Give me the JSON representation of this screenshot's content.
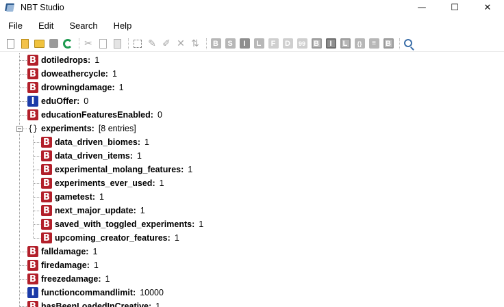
{
  "window": {
    "title": "NBT Studio",
    "controls": {
      "minimize": "—",
      "maximize": "☐",
      "close": "✕"
    }
  },
  "menu": [
    "File",
    "Edit",
    "Search",
    "Help"
  ],
  "toolbar": {
    "tag_buttons": [
      "B",
      "S",
      "I",
      "L",
      "F",
      "D",
      "99",
      "B",
      "I",
      "L",
      "{}",
      "B"
    ]
  },
  "tree": {
    "items": [
      {
        "type": "byte",
        "name": "dotiledrops:",
        "value": "1",
        "depth": 0
      },
      {
        "type": "byte",
        "name": "doweathercycle:",
        "value": "1",
        "depth": 0
      },
      {
        "type": "byte",
        "name": "drowningdamage:",
        "value": "1",
        "depth": 0
      },
      {
        "type": "int",
        "name": "eduOffer:",
        "value": "0",
        "depth": 0
      },
      {
        "type": "byte",
        "name": "educationFeaturesEnabled:",
        "value": "0",
        "depth": 0
      },
      {
        "type": "compound",
        "name": "experiments:",
        "value": "[8 entries]",
        "depth": 0,
        "expanded": true
      },
      {
        "type": "byte",
        "name": "data_driven_biomes:",
        "value": "1",
        "depth": 1
      },
      {
        "type": "byte",
        "name": "data_driven_items:",
        "value": "1",
        "depth": 1
      },
      {
        "type": "byte",
        "name": "experimental_molang_features:",
        "value": "1",
        "depth": 1
      },
      {
        "type": "byte",
        "name": "experiments_ever_used:",
        "value": "1",
        "depth": 1
      },
      {
        "type": "byte",
        "name": "gametest:",
        "value": "1",
        "depth": 1
      },
      {
        "type": "byte",
        "name": "next_major_update:",
        "value": "1",
        "depth": 1
      },
      {
        "type": "byte",
        "name": "saved_with_toggled_experiments:",
        "value": "1",
        "depth": 1
      },
      {
        "type": "byte",
        "name": "upcoming_creator_features:",
        "value": "1",
        "depth": 1
      },
      {
        "type": "byte",
        "name": "falldamage:",
        "value": "1",
        "depth": 0
      },
      {
        "type": "byte",
        "name": "firedamage:",
        "value": "1",
        "depth": 0
      },
      {
        "type": "byte",
        "name": "freezedamage:",
        "value": "1",
        "depth": 0
      },
      {
        "type": "int",
        "name": "functioncommandlimit:",
        "value": "10000",
        "depth": 0
      },
      {
        "type": "byte",
        "name": "hasBeenLoadedInCreative:",
        "value": "1",
        "depth": 0
      }
    ],
    "badge_letters": {
      "byte": "B",
      "int": "I",
      "compound": "{}"
    }
  },
  "colors": {
    "byte_badge": "#b21f2a",
    "int_badge": "#1b3ba8"
  }
}
